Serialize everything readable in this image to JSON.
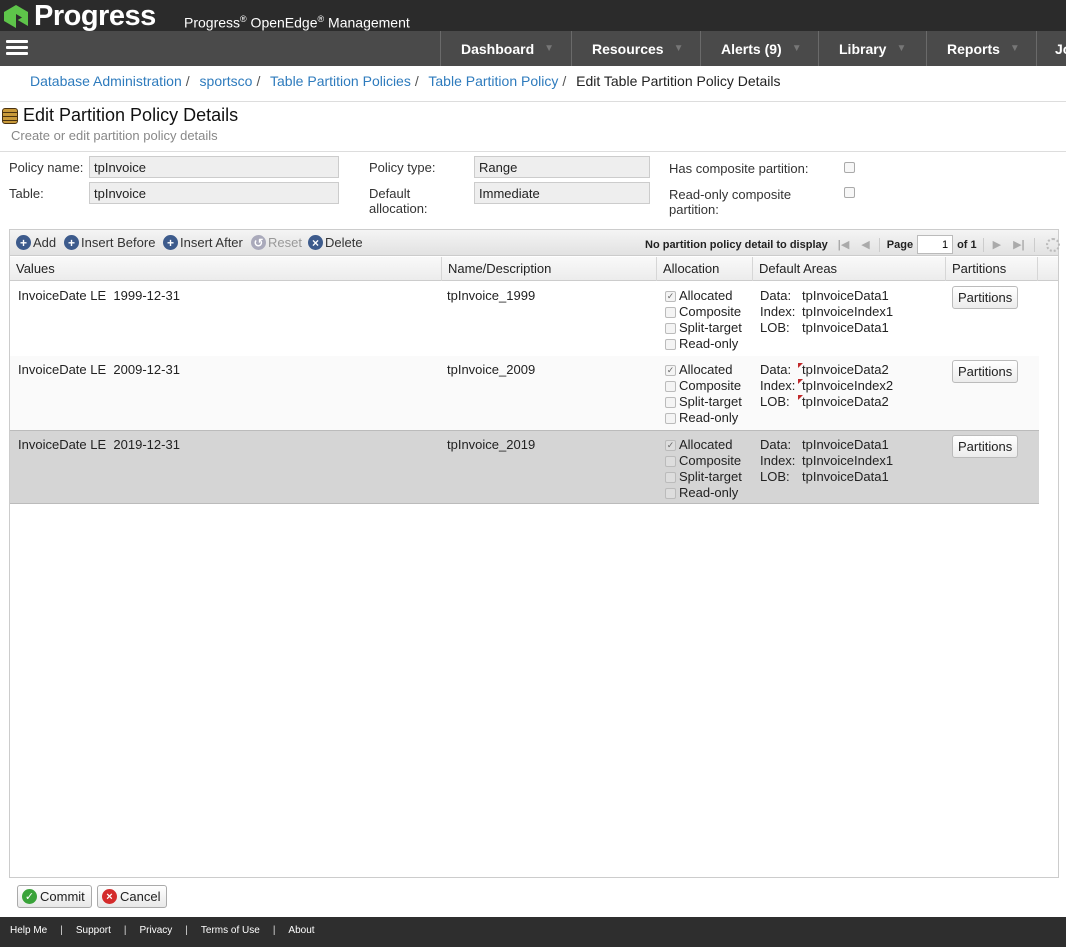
{
  "brand": {
    "logo_text": "Progress",
    "product_prefix": "Progress",
    "product_mid": " OpenEdge",
    "product_suffix": " Management",
    "reg": "®"
  },
  "nav": [
    {
      "label": "Dashboard"
    },
    {
      "label": "Resources"
    },
    {
      "label": "Alerts (9)"
    },
    {
      "label": "Library"
    },
    {
      "label": "Reports"
    },
    {
      "label": "Jo"
    }
  ],
  "breadcrumb": {
    "items": [
      "Database Administration",
      "sportsco",
      "Table Partition Policies",
      "Table Partition Policy"
    ],
    "current": "Edit Table Partition Policy Details",
    "sep": "/"
  },
  "page": {
    "title": "Edit Partition Policy Details",
    "subtitle": "Create or edit partition policy details"
  },
  "form": {
    "policy_name_label": "Policy name:",
    "policy_name_value": "tpInvoice",
    "table_label": "Table:",
    "table_value": "tpInvoice",
    "policy_type_label": "Policy type:",
    "policy_type_value": "Range",
    "default_alloc_label_1": "Default",
    "default_alloc_label_2": "allocation:",
    "default_alloc_value": "Immediate",
    "composite_label": "Has composite partition:",
    "readonly_label_1": "Read-only composite",
    "readonly_label_2": "partition:"
  },
  "toolbar": {
    "add": "Add",
    "insert_before": "Insert Before",
    "insert_after": "Insert After",
    "reset": "Reset",
    "delete": "Delete",
    "status": "No partition policy detail to display",
    "page_label": "Page",
    "page_value": "1",
    "of_label": "of 1"
  },
  "columns": [
    "Values",
    "Name/Description",
    "Allocation",
    "Default Areas",
    "Partitions"
  ],
  "rows": [
    {
      "field": "InvoiceDate",
      "op": "LE",
      "value": "1999-12-31",
      "name": "tpInvoice_1999",
      "alloc": [
        "Allocated",
        "Composite",
        "Split-target",
        "Read-only"
      ],
      "area_keys": [
        "Data:",
        "Index:",
        "LOB:"
      ],
      "areas": [
        "tpInvoiceData1",
        "tpInvoiceIndex1",
        "tpInvoiceData1"
      ],
      "button": "Partitions"
    },
    {
      "field": "InvoiceDate",
      "op": "LE",
      "value": "2009-12-31",
      "name": "tpInvoice_2009",
      "alloc": [
        "Allocated",
        "Composite",
        "Split-target",
        "Read-only"
      ],
      "area_keys": [
        "Data:",
        "Index:",
        "LOB:"
      ],
      "areas": [
        "tpInvoiceData2",
        "tpInvoiceIndex2",
        "tpInvoiceData2"
      ],
      "button": "Partitions"
    },
    {
      "field": "InvoiceDate",
      "op": "LE",
      "value": "2019-12-31",
      "name": "tpInvoice_2019",
      "alloc": [
        "Allocated",
        "Composite",
        "Split-target",
        "Read-only"
      ],
      "area_keys": [
        "Data:",
        "Index:",
        "LOB:"
      ],
      "areas": [
        "tpInvoiceData1",
        "tpInvoiceIndex1",
        "tpInvoiceData1"
      ],
      "button": "Partitions"
    }
  ],
  "actions": {
    "commit": "Commit",
    "cancel": "Cancel"
  },
  "footer": [
    "Help Me",
    "Support",
    "Privacy",
    "Terms of Use",
    "About"
  ],
  "colors": {
    "link": "#2e7bbd",
    "topbar": "#2b2b2b",
    "navbar": "#4a4a4a",
    "logo_green": "#5ec44a"
  }
}
